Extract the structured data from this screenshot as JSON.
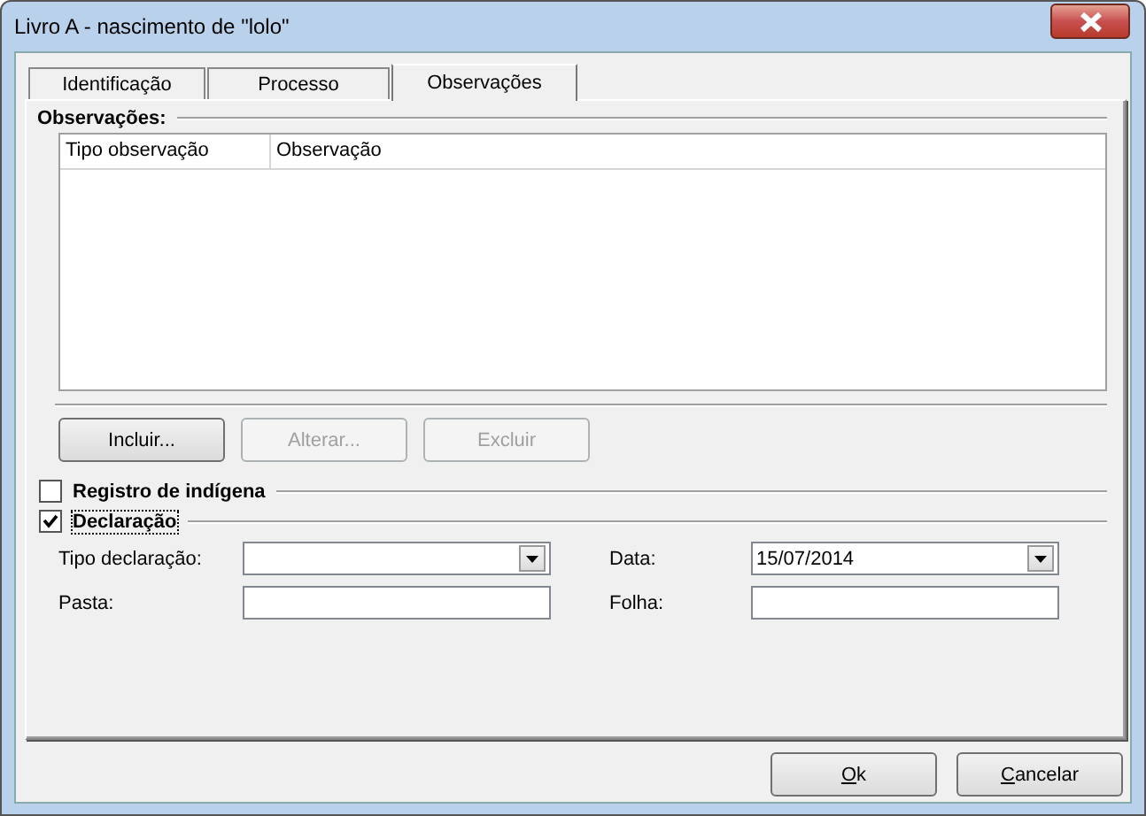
{
  "window": {
    "title": "Livro A - nascimento de \"lolo\""
  },
  "tabs": [
    {
      "label": "Identificação",
      "selected": false
    },
    {
      "label": "Processo",
      "selected": false
    },
    {
      "label": "Observações",
      "selected": true
    }
  ],
  "observacoes": {
    "title": "Observações:",
    "columns": [
      "Tipo observação",
      "Observação"
    ],
    "buttons": [
      {
        "label": "Incluir...",
        "disabled": false
      },
      {
        "label": "Alterar...",
        "disabled": true
      },
      {
        "label": "Excluir",
        "disabled": true
      }
    ]
  },
  "sections": [
    {
      "label": "Registro de indígena",
      "checked": false,
      "focused": false
    },
    {
      "label": "Declaração",
      "checked": true,
      "focused": true
    }
  ],
  "fields": [
    {
      "kind": "combo",
      "label": "Tipo declaração:"
    },
    {
      "kind": "combo",
      "label": "Data:",
      "value": "15/07/2014"
    },
    {
      "kind": "text",
      "label": "Pasta:"
    },
    {
      "kind": "text",
      "label": "Folha:"
    }
  ],
  "footer_buttons": [
    {
      "label": "Ok",
      "first_letter_underlined": true
    },
    {
      "label": "Cancelar",
      "first_letter_underlined": true
    }
  ]
}
